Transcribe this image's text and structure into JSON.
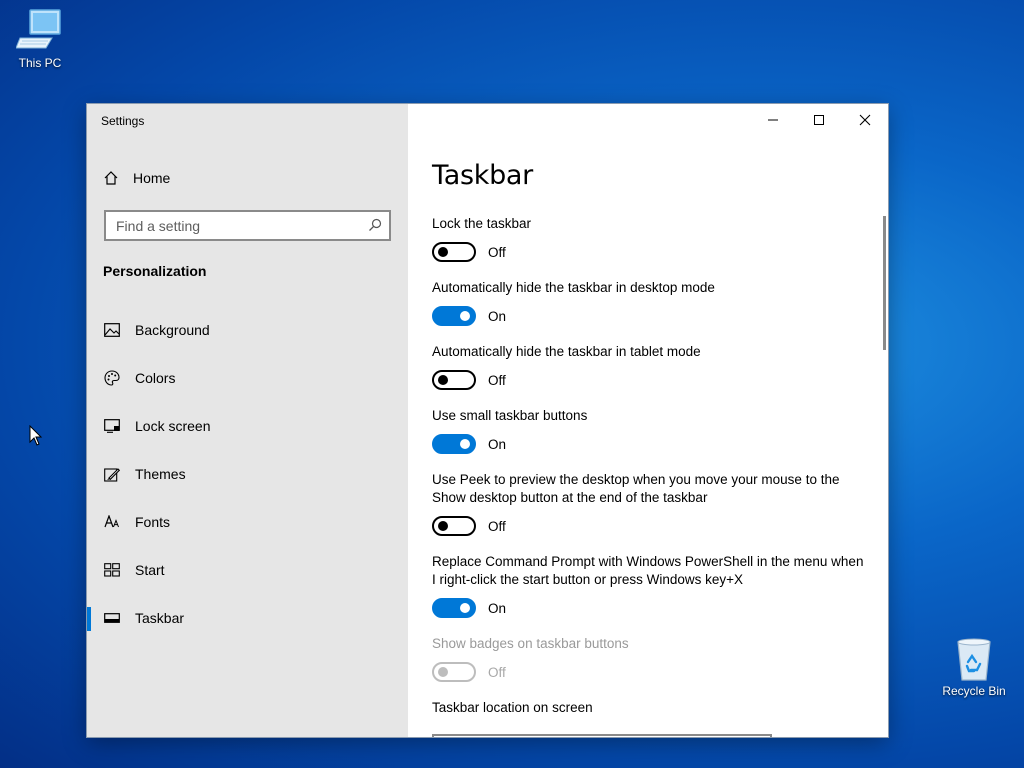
{
  "desktop": {
    "icons": [
      {
        "label": "This PC",
        "icon": "this-pc-icon"
      },
      {
        "label": "Recycle Bin",
        "icon": "recycle-bin-icon"
      }
    ]
  },
  "window": {
    "title": "Settings",
    "controls": {
      "minimize": "minimize-icon",
      "maximize": "maximize-icon",
      "close": "close-icon"
    }
  },
  "sidebar": {
    "home_label": "Home",
    "search_placeholder": "Find a setting",
    "section_heading": "Personalization",
    "items": [
      {
        "label": "Background",
        "icon": "background-icon"
      },
      {
        "label": "Colors",
        "icon": "colors-palette-icon"
      },
      {
        "label": "Lock screen",
        "icon": "lock-screen-icon"
      },
      {
        "label": "Themes",
        "icon": "themes-icon"
      },
      {
        "label": "Fonts",
        "icon": "fonts-icon"
      },
      {
        "label": "Start",
        "icon": "start-icon"
      },
      {
        "label": "Taskbar",
        "icon": "taskbar-icon",
        "selected": true
      }
    ]
  },
  "content": {
    "page_title": "Taskbar",
    "settings": [
      {
        "label": "Lock the taskbar",
        "state": "Off",
        "on": false,
        "enabled": true
      },
      {
        "label": "Automatically hide the taskbar in desktop mode",
        "state": "On",
        "on": true,
        "enabled": true
      },
      {
        "label": "Automatically hide the taskbar in tablet mode",
        "state": "Off",
        "on": false,
        "enabled": true
      },
      {
        "label": "Use small taskbar buttons",
        "state": "On",
        "on": true,
        "enabled": true
      },
      {
        "label": "Use Peek to preview the desktop when you move your mouse to the Show desktop button at the end of the taskbar",
        "state": "Off",
        "on": false,
        "enabled": true
      },
      {
        "label": "Replace Command Prompt with Windows PowerShell in the menu when I right-click the start button or press Windows key+X",
        "state": "On",
        "on": true,
        "enabled": true
      },
      {
        "label": "Show badges on taskbar buttons",
        "state": "Off",
        "on": false,
        "enabled": false
      },
      {
        "label": "Taskbar location on screen"
      }
    ]
  },
  "colors": {
    "accent": "#0078d7",
    "sidebar_bg": "#e6e6e6",
    "disabled": "#9a9a9a"
  }
}
